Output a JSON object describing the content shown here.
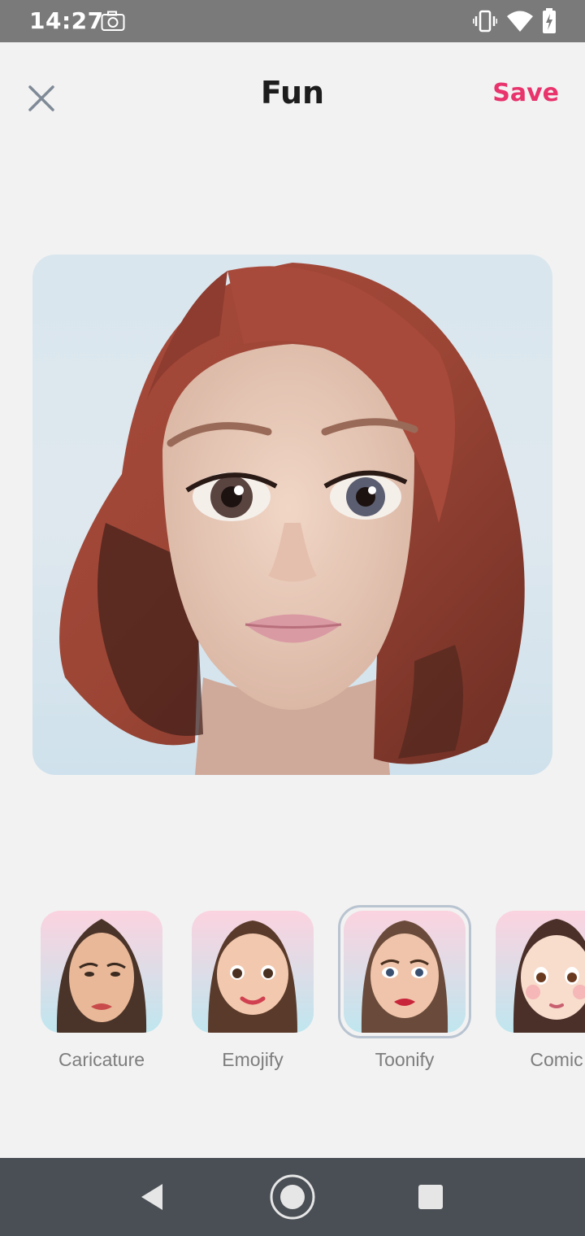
{
  "status_bar": {
    "time": "14:27",
    "icons": [
      "camera-icon",
      "vibrate-icon",
      "wifi-icon",
      "battery-icon"
    ]
  },
  "header": {
    "title": "Fun",
    "save_label": "Save",
    "close_icon": "close-icon"
  },
  "colors": {
    "accent": "#e8336d",
    "background": "#f2f2f2",
    "status_bar": "#7a7a7a",
    "nav_bar": "#4a4f55",
    "selected_ring": "#b9c4d1"
  },
  "filters": [
    {
      "label": "Caricature",
      "selected": false
    },
    {
      "label": "Emojify",
      "selected": false
    },
    {
      "label": "Toonify",
      "selected": true
    },
    {
      "label": "Comic",
      "selected": false
    }
  ],
  "nav_bar": {
    "icons": [
      "back-icon",
      "home-icon",
      "recents-icon"
    ]
  }
}
